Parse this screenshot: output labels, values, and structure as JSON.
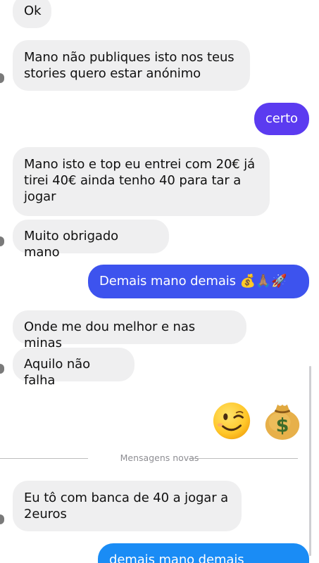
{
  "colors": {
    "incoming_bg": "#efeff0",
    "outgoing_purple": "#5b3bf0",
    "outgoing_blue_indigo": "#3d53ee",
    "outgoing_blue": "#1a8cf5"
  },
  "messages": [
    {
      "id": "m1",
      "dir": "in",
      "text": "Ok"
    },
    {
      "id": "m2",
      "dir": "in",
      "text": "Mano não publiques isto nos teus\nstories quero estar anónimo"
    },
    {
      "id": "m3",
      "dir": "out",
      "text": "certo"
    },
    {
      "id": "m4",
      "dir": "in",
      "text": "Mano isto e top eu entrei com 20€ já\ntirei 40€ ainda tenho 40  para tar a\njogar"
    },
    {
      "id": "m5",
      "dir": "in",
      "text": "Muito obrigado mano"
    },
    {
      "id": "m6",
      "dir": "out",
      "text": "Demais mano demais 💰🙏🏽🚀"
    },
    {
      "id": "m7",
      "dir": "in",
      "text": "Onde me dou melhor e nas minas"
    },
    {
      "id": "m8",
      "dir": "in",
      "text": "Aquilo não falha"
    },
    {
      "id": "m9",
      "dir": "out",
      "text": "😉💰",
      "icons": [
        "wink-emoji-icon",
        "money-bag-emoji-icon"
      ]
    },
    {
      "id": "m10",
      "dir": "in",
      "text": "Eu tô com banca de 40 a jogar a\n2euros"
    },
    {
      "id": "m11",
      "dir": "out",
      "text": "demais mano demais mesmo!"
    }
  ],
  "divider": {
    "label": "Mensagens novas"
  }
}
